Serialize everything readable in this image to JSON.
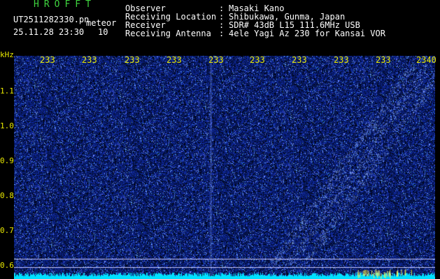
{
  "header": {
    "brand": "HROFFT",
    "file": "UT2511282330.pn",
    "meteor_label": "meteor",
    "datetime": "25.11.28 23:30",
    "count": "10",
    "fields": [
      {
        "label": "Observer",
        "value": "Masaki Kano"
      },
      {
        "label": "Receiving Location",
        "value": "Shibukawa, Gunma, Japan"
      },
      {
        "label": "Receiver",
        "value": "SDR# 43dB L15 111.6MHz USB"
      },
      {
        "label": "Receiving Antenna",
        "value": "4ele Yagi Az 230 for Kansai VOR"
      }
    ]
  },
  "y_axis": {
    "unit": "kHz",
    "ticks": [
      "1.1",
      "1.0",
      "0.9",
      "0.8",
      "0.7",
      "0.6"
    ]
  },
  "x_axis": {
    "ticks": [
      "233",
      "233",
      "233",
      "233",
      "233",
      "233",
      "233",
      "233",
      "233",
      "2340"
    ]
  },
  "colors": {
    "background": "#000000",
    "noise_base": "#0a1a8a",
    "noise_bright": "#5a7aff",
    "trail": "#8fb0ff",
    "baseline": "#00e0ff",
    "hlines": "#c8c8ff",
    "text_yellow": "#e8e800",
    "brand_green": "#3fd43f"
  }
}
